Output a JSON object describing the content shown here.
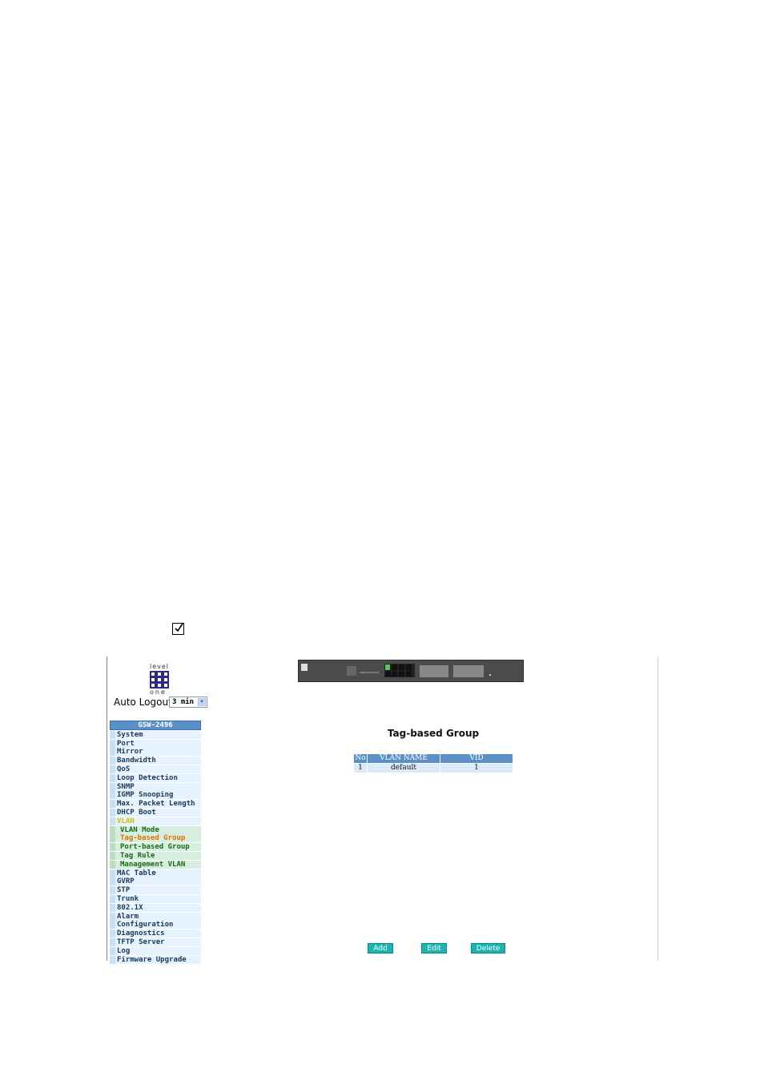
{
  "logo": {
    "top_text": "level",
    "bottom_text": "one"
  },
  "auto_logout": {
    "label": "Auto Logout",
    "value": "3 min"
  },
  "menu": {
    "header": "GSW-2496",
    "items": [
      {
        "label": "System",
        "type": "item"
      },
      {
        "label": "Port",
        "type": "item"
      },
      {
        "label": "Mirror",
        "type": "item"
      },
      {
        "label": "Bandwidth",
        "type": "item"
      },
      {
        "label": "QoS",
        "type": "item"
      },
      {
        "label": "Loop Detection",
        "type": "item"
      },
      {
        "label": "SNMP",
        "type": "item"
      },
      {
        "label": "IGMP Snooping",
        "type": "item"
      },
      {
        "label": "Max. Packet Length",
        "type": "item"
      },
      {
        "label": "DHCP Boot",
        "type": "item"
      },
      {
        "label": "VLAN",
        "type": "active"
      },
      {
        "label": "VLAN Mode",
        "type": "sub"
      },
      {
        "label": "Tag-based Group",
        "type": "sub-current"
      },
      {
        "label": "Port-based Group",
        "type": "sub"
      },
      {
        "label": "Tag Rule",
        "type": "sub"
      },
      {
        "label": "Management VLAN",
        "type": "sub"
      },
      {
        "label": "MAC Table",
        "type": "item"
      },
      {
        "label": "GVRP",
        "type": "item"
      },
      {
        "label": "STP",
        "type": "item"
      },
      {
        "label": "Trunk",
        "type": "item"
      },
      {
        "label": "802.1X",
        "type": "item"
      },
      {
        "label": "Alarm",
        "type": "item"
      },
      {
        "label": "Configuration",
        "type": "item"
      },
      {
        "label": "Diagnostics",
        "type": "item"
      },
      {
        "label": "TFTP Server",
        "type": "item"
      },
      {
        "label": "Log",
        "type": "item"
      },
      {
        "label": "Firmware Upgrade",
        "type": "item"
      }
    ]
  },
  "main": {
    "title": "Tag-based Group",
    "table": {
      "headers": [
        "No",
        "VLAN NAME",
        "VID"
      ],
      "rows": [
        [
          "1",
          "default",
          "1"
        ]
      ]
    },
    "buttons": {
      "add": "Add",
      "edit": "Edit",
      "delete": "Delete"
    }
  }
}
